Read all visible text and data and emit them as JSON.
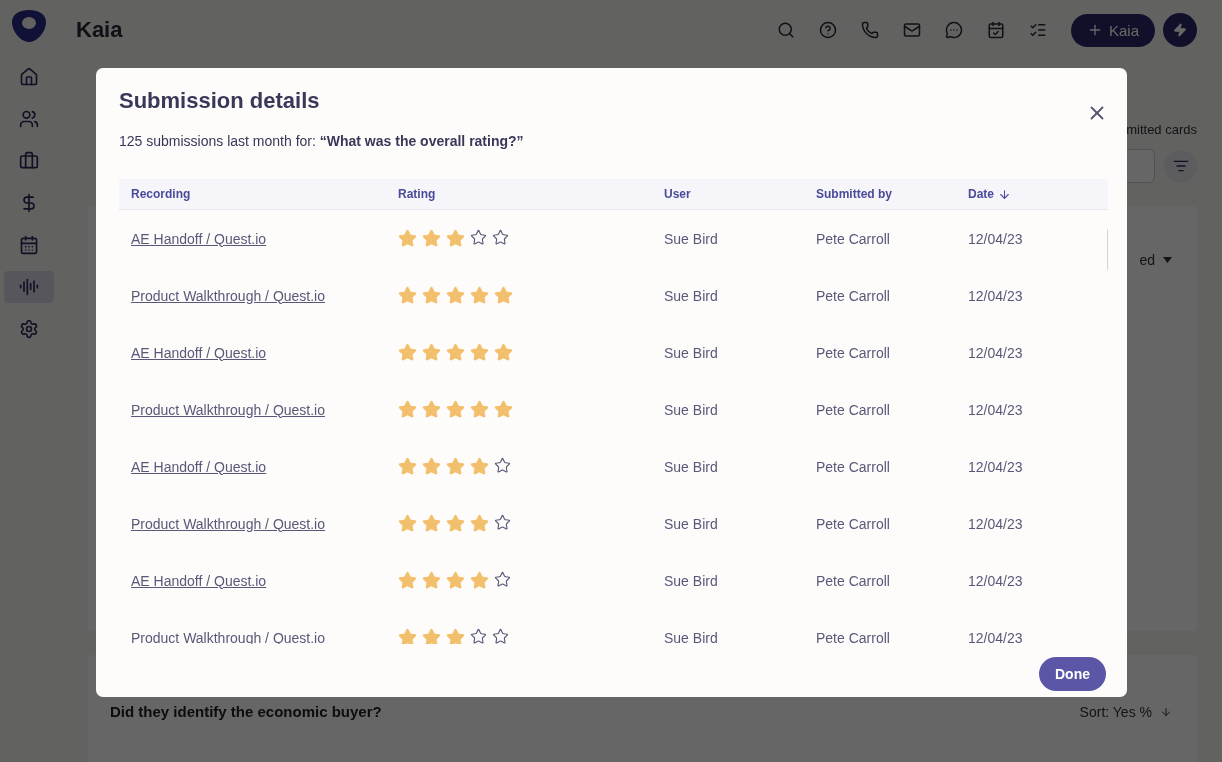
{
  "app": {
    "title": "Kaia",
    "new_button": "Kaia"
  },
  "sidebar": {
    "items": [
      {
        "selected": false
      },
      {
        "selected": false
      },
      {
        "selected": false
      },
      {
        "selected": false
      },
      {
        "selected": false
      },
      {
        "selected": true
      },
      {
        "selected": false
      }
    ]
  },
  "background": {
    "cards_label": "mitted cards",
    "dropdown_label": "ed",
    "question": "Did they identify the economic buyer?",
    "sort": "Sort: Yes %"
  },
  "dialog": {
    "title": "Submission details",
    "subtitle": "125 submissions last month for: **“What was the overall rating?”**",
    "columns": [
      {
        "label": "Recording",
        "sorted": false
      },
      {
        "label": "Rating",
        "sorted": false
      },
      {
        "label": "User",
        "sorted": false
      },
      {
        "label": "Submitted by",
        "sorted": false
      },
      {
        "label": "Date",
        "sorted": true
      }
    ],
    "rows": [
      {
        "recording": "AE Handoff / Quest.io",
        "stars": 3,
        "user": "Sue Bird",
        "submitted_by": "Pete Carroll",
        "date": "12/04/23"
      },
      {
        "recording": "Product Walkthrough / Quest.io",
        "stars": 5,
        "user": "Sue Bird",
        "submitted_by": "Pete Carroll",
        "date": "12/04/23"
      },
      {
        "recording": "AE Handoff / Quest.io",
        "stars": 5,
        "user": "Sue Bird",
        "submitted_by": "Pete Carroll",
        "date": "12/04/23"
      },
      {
        "recording": "Product Walkthrough / Quest.io",
        "stars": 5,
        "user": "Sue Bird",
        "submitted_by": "Pete Carroll",
        "date": "12/04/23"
      },
      {
        "recording": "AE Handoff / Quest.io",
        "stars": 4,
        "user": "Sue Bird",
        "submitted_by": "Pete Carroll",
        "date": "12/04/23"
      },
      {
        "recording": "Product Walkthrough / Quest.io",
        "stars": 4,
        "user": "Sue Bird",
        "submitted_by": "Pete Carroll",
        "date": "12/04/23"
      },
      {
        "recording": "AE Handoff / Quest.io",
        "stars": 4,
        "user": "Sue Bird",
        "submitted_by": "Pete Carroll",
        "date": "12/04/23"
      },
      {
        "recording": "Product Walkthrough / Quest.io",
        "stars": 3,
        "user": "Sue Bird",
        "submitted_by": "Pete Carroll",
        "date": "12/04/23"
      }
    ],
    "done_button": "Done"
  }
}
